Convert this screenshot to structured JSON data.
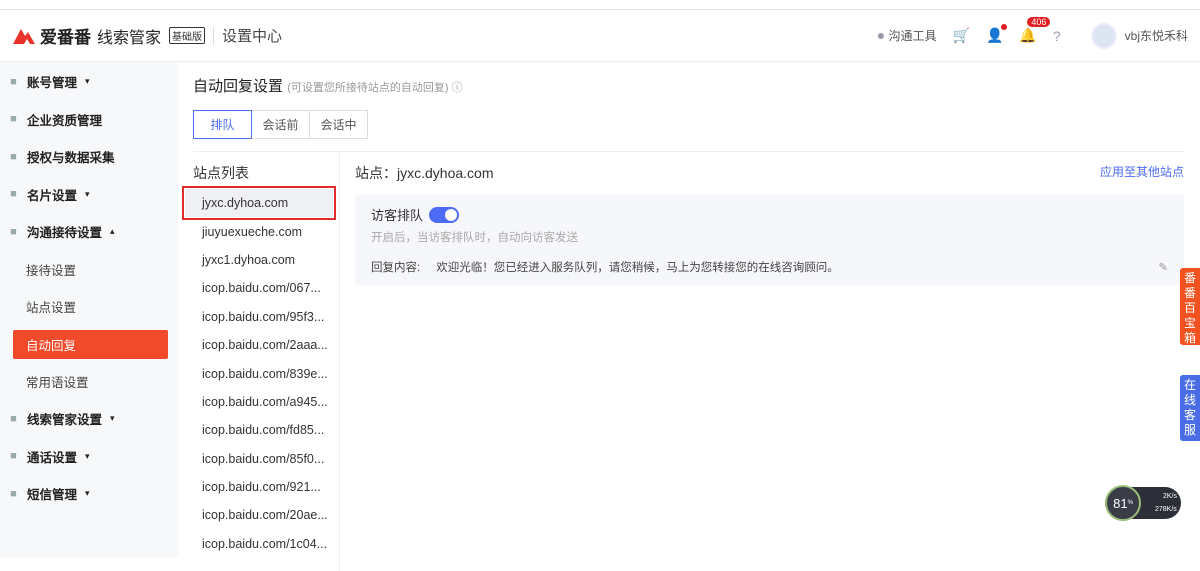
{
  "header": {
    "brand": "爱番番",
    "product": "线索管家",
    "edition": "基础版",
    "section": "设置中心",
    "tools": "沟通工具",
    "notifications": "406",
    "user": "vbj东悦禾科"
  },
  "sidebar": [
    {
      "label": "账号管理",
      "caret": "▾",
      "icon": "account-icon"
    },
    {
      "label": "企业资质管理",
      "icon": "doc-icon"
    },
    {
      "label": "授权与数据采集",
      "icon": "lock-icon"
    },
    {
      "label": "名片设置",
      "caret": "▾",
      "icon": "card-icon"
    },
    {
      "label": "沟通接待设置",
      "caret": "▴",
      "icon": "chat-icon"
    },
    {
      "label": "接待设置",
      "sub": true
    },
    {
      "label": "站点设置",
      "sub": true
    },
    {
      "label": "自动回复",
      "sub": true,
      "active": true
    },
    {
      "label": "常用语设置",
      "sub": true
    },
    {
      "label": "线索管家设置",
      "caret": "▾",
      "icon": "list-icon"
    },
    {
      "label": "通话设置",
      "caret": "▾",
      "icon": "phone-icon"
    },
    {
      "label": "短信管理",
      "caret": "▾",
      "icon": "sms-icon"
    }
  ],
  "main": {
    "title": "自动回复设置",
    "subtitle": "(可设置您所接待站点的自动回复) ⓘ",
    "tabs": [
      "排队",
      "会话前",
      "会话中"
    ],
    "list_title": "站点列表",
    "sites": [
      "jyxc.dyhoa.com",
      "jiuyuexueche.com",
      "jyxc1.dyhoa.com",
      "icop.baidu.com/067...",
      "icop.baidu.com/95f3...",
      "icop.baidu.com/2aaa...",
      "icop.baidu.com/839e...",
      "icop.baidu.com/a945...",
      "icop.baidu.com/fd85...",
      "icop.baidu.com/85f0...",
      "icop.baidu.com/921...",
      "icop.baidu.com/20ae...",
      "icop.baidu.com/1c04..."
    ],
    "site_label": "站点：jyxc.dyhoa.com",
    "apply": "应用至其他站点",
    "queue_label": "访客排队",
    "queue_enabled": true,
    "hint": "开启后，当访客排队时，自动向访客发送",
    "reply_label": "回复内容:",
    "reply_text": "欢迎光临！您已经进入服务队列，请您稍候，马上为您转接您的在线咨询顾问。"
  },
  "float": {
    "toolbox": "番番百宝箱",
    "service": "在线客服"
  },
  "gauge": {
    "percent": "81",
    "unit": "%",
    "up": "2K/s",
    "down": "278K/s"
  },
  "colors": {
    "accent": "#4d6bf5",
    "brand": "#f04a2b"
  }
}
